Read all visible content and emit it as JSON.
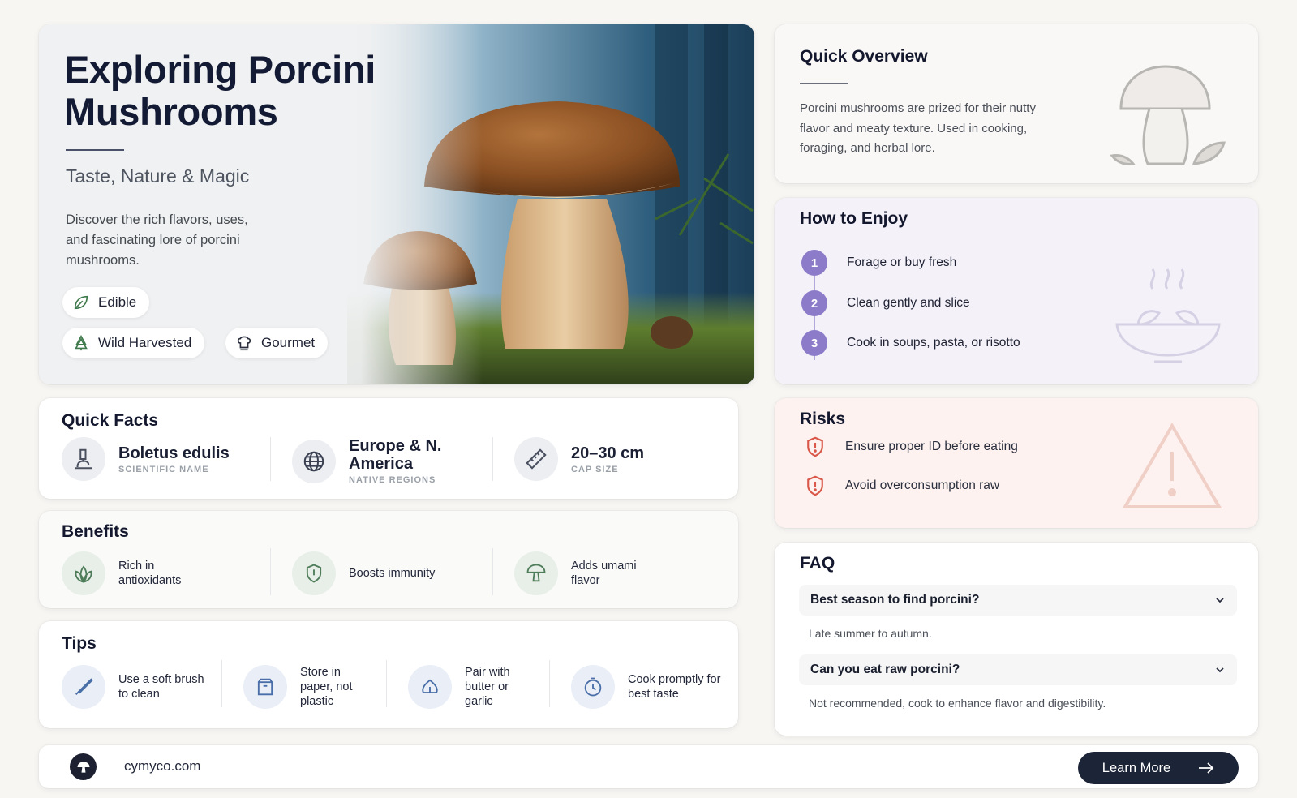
{
  "hero": {
    "title": "Exploring Porcini Mushrooms",
    "subtitle": "Taste, Nature & Magic",
    "description": "Discover the rich flavors, uses, and fascinating lore of porcini mushrooms.",
    "tags": [
      {
        "label": "Edible",
        "icon": "leaf-icon"
      },
      {
        "label": "Wild Harvested",
        "icon": "tree-icon"
      },
      {
        "label": "Gourmet",
        "icon": "chef-hat-icon"
      }
    ]
  },
  "quick_facts": {
    "title": "Quick Facts",
    "items": [
      {
        "value": "Boletus edulis",
        "label": "SCIENTIFIC NAME",
        "icon": "microscope-icon"
      },
      {
        "value": "Europe & N. America",
        "label": "NATIVE REGIONS",
        "icon": "globe-icon"
      },
      {
        "value": "20–30 cm",
        "label": "CAP SIZE",
        "icon": "ruler-icon"
      }
    ]
  },
  "benefits": {
    "title": "Benefits",
    "items": [
      {
        "label": "Rich in antioxidants",
        "icon": "leaves-icon"
      },
      {
        "label": "Boosts immunity",
        "icon": "shield-icon"
      },
      {
        "label": "Adds umami flavor",
        "icon": "mushroom-icon"
      }
    ]
  },
  "tips": {
    "title": "Tips",
    "items": [
      {
        "label": "Use a soft brush to clean",
        "icon": "brush-icon"
      },
      {
        "label": "Store in paper, not plastic",
        "icon": "paper-bag-icon"
      },
      {
        "label": "Pair with butter or garlic",
        "icon": "garlic-icon"
      },
      {
        "label": "Cook promptly for best taste",
        "icon": "timer-icon"
      }
    ]
  },
  "overview": {
    "title": "Quick Overview",
    "text": "Porcini mushrooms are prized for their nutty flavor and meaty texture. Used in cooking, foraging, and herbal lore."
  },
  "enjoy": {
    "title": "How to Enjoy",
    "steps": [
      {
        "num": "1",
        "label": "Forage or buy fresh"
      },
      {
        "num": "2",
        "label": "Clean gently and slice"
      },
      {
        "num": "3",
        "label": "Cook in soups, pasta, or risotto"
      }
    ]
  },
  "risks": {
    "title": "Risks",
    "items": [
      {
        "label": "Ensure proper ID before eating"
      },
      {
        "label": "Avoid overconsumption raw"
      }
    ]
  },
  "faq": {
    "title": "FAQ",
    "items": [
      {
        "question": "Best season to find porcini?",
        "answer": "Late summer to autumn."
      },
      {
        "question": "Can you eat raw porcini?",
        "answer": "Not recommended, cook to enhance flavor and digestibility."
      }
    ]
  },
  "footer": {
    "site": "cymyco.com",
    "button_label": "Learn More"
  },
  "colors": {
    "navy": "#1c2438",
    "accent_purple": "#8c7bc9",
    "risk_red": "#d9584a",
    "benefit_green": "#4f7d5a",
    "tip_blue": "#4a6fa8"
  }
}
